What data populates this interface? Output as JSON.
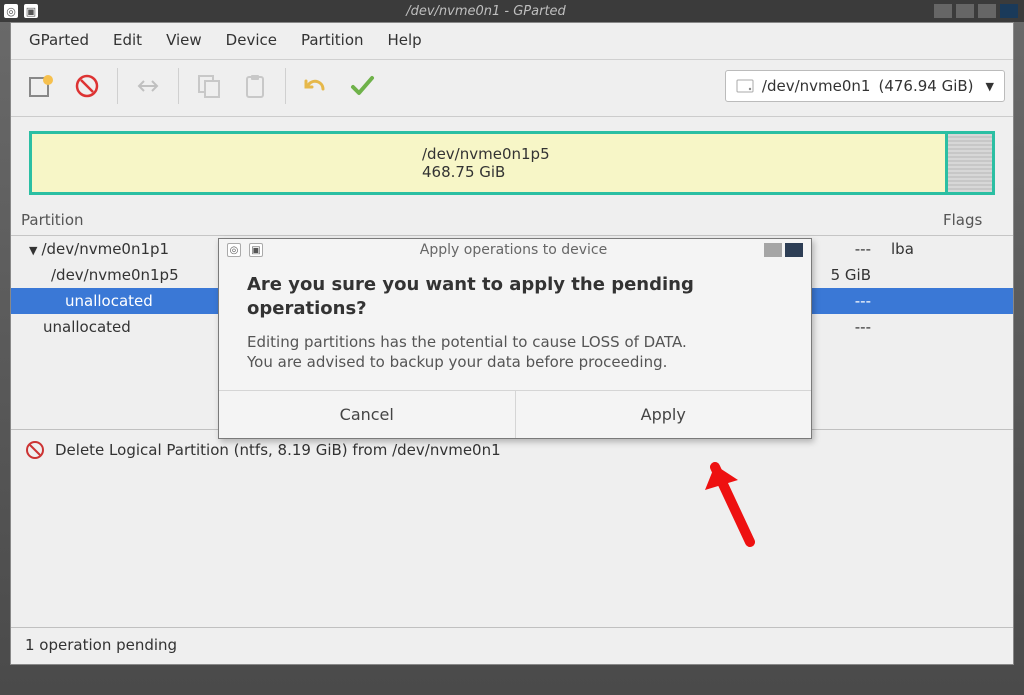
{
  "desktop": {
    "title": "/dev/nvme0n1 - GParted"
  },
  "menu": {
    "items": [
      "GParted",
      "Edit",
      "View",
      "Device",
      "Partition",
      "Help"
    ]
  },
  "device_chooser": {
    "name": "/dev/nvme0n1",
    "size": "(476.94 GiB)"
  },
  "pmap": {
    "name": "/dev/nvme0n1p5",
    "size": "468.75 GiB"
  },
  "columns": {
    "partition": "Partition",
    "flags": "Flags"
  },
  "rows": [
    {
      "name": "/dev/nvme0n1p1",
      "trail": "---",
      "flags": "lba",
      "indent": 0,
      "expander": true
    },
    {
      "name": "/dev/nvme0n1p5",
      "trail": "5 GiB",
      "flags": "",
      "indent": 1
    },
    {
      "name": "unallocated",
      "trail": "---",
      "flags": "",
      "indent": 2,
      "selected": true
    },
    {
      "name": "unallocated",
      "trail": "---",
      "flags": "",
      "indent": 0
    }
  ],
  "pending_op": {
    "text": "Delete Logical Partition (ntfs, 8.19 GiB) from /dev/nvme0n1"
  },
  "status": {
    "text": "1 operation pending"
  },
  "dialog": {
    "title": "Apply operations to device",
    "heading": "Are you sure you want to apply the pending operations?",
    "body1": "Editing partitions has the potential to cause LOSS of DATA.",
    "body2": "You are advised to backup your data before proceeding.",
    "cancel": "Cancel",
    "apply": "Apply"
  }
}
